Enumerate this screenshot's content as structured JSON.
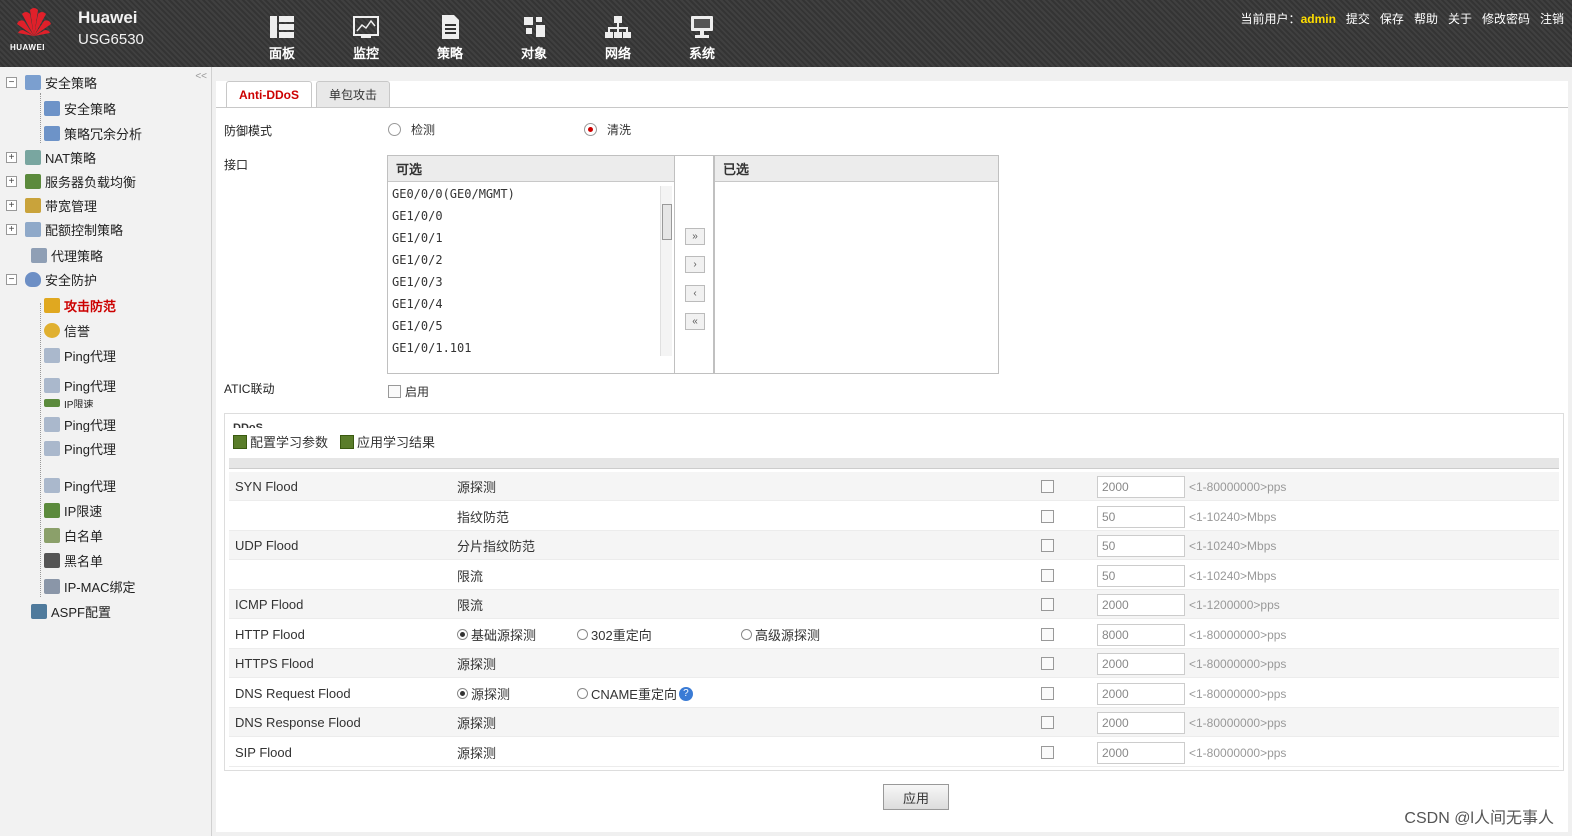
{
  "header": {
    "logo_text": "HUAWEI",
    "brand": "Huawei",
    "model": "USG6530",
    "nav": [
      {
        "label": "面板",
        "icon": "dashboard-icon"
      },
      {
        "label": "监控",
        "icon": "monitor-icon"
      },
      {
        "label": "策略",
        "icon": "policy-icon"
      },
      {
        "label": "对象",
        "icon": "object-icon"
      },
      {
        "label": "网络",
        "icon": "network-icon"
      },
      {
        "label": "系统",
        "icon": "system-icon"
      }
    ],
    "user_prefix": "当前用户：",
    "user": "admin",
    "links": [
      "提交",
      "保存",
      "帮助",
      "关于",
      "修改密码",
      "注销"
    ]
  },
  "sidebar": {
    "collapse": "<<",
    "items": [
      {
        "label": "安全策略",
        "expander": "−"
      },
      {
        "label": "安全策略"
      },
      {
        "label": "策略冗余分析"
      },
      {
        "label": "NAT策略",
        "expander": "+"
      },
      {
        "label": "服务器负载均衡",
        "expander": "+"
      },
      {
        "label": "带宽管理",
        "expander": "+"
      },
      {
        "label": "配额控制策略",
        "expander": "+"
      },
      {
        "label": "代理策略"
      },
      {
        "label": "安全防护",
        "expander": "−"
      },
      {
        "label": "攻击防范"
      },
      {
        "label": "信誉"
      },
      {
        "label": "Ping代理"
      },
      {
        "label": "Ping代理"
      },
      {
        "label": "IP限速"
      },
      {
        "label": "Ping代理"
      },
      {
        "label": "Ping代理"
      },
      {
        "label": "Ping代理"
      },
      {
        "label": "IP限速"
      },
      {
        "label": "白名单"
      },
      {
        "label": "黑名单"
      },
      {
        "label": "IP-MAC绑定"
      },
      {
        "label": "ASPF配置"
      }
    ]
  },
  "tabs": [
    "Anti-DDoS",
    "单包攻击"
  ],
  "form": {
    "mode_label": "防御模式",
    "mode_options": [
      "检测",
      "清洗"
    ],
    "interface_label": "接口",
    "available_header": "可选",
    "selected_header": "已选",
    "interfaces": [
      "GE0/0/0(GE0/MGMT)",
      "GE1/0/0",
      "GE1/0/1",
      "GE1/0/2",
      "GE1/0/3",
      "GE1/0/4",
      "GE1/0/5",
      "GE1/0/1.101"
    ],
    "move_buttons": [
      "»",
      "›",
      "‹",
      "«"
    ],
    "atic_label": "ATIC联动",
    "atic_option": "启用"
  },
  "ddos": {
    "title": "DDoS",
    "toolbar": [
      "配置学习参数",
      "应用学习结果"
    ],
    "rows": [
      {
        "type": "SYN Flood",
        "method": "源探测",
        "value": "2000",
        "range": "<1-80000000>pps"
      },
      {
        "type": "",
        "method": "指纹防范",
        "value": "50",
        "range": "<1-10240>Mbps"
      },
      {
        "type": "UDP Flood",
        "method": "分片指纹防范",
        "value": "50",
        "range": "<1-10240>Mbps"
      },
      {
        "type": "",
        "method": "限流",
        "value": "50",
        "range": "<1-10240>Mbps"
      },
      {
        "type": "ICMP Flood",
        "method": "限流",
        "value": "2000",
        "range": "<1-1200000>pps"
      },
      {
        "type": "HTTP Flood",
        "options": [
          "基础源探测",
          "302重定向",
          "高级源探测"
        ],
        "value": "8000",
        "range": "<1-80000000>pps"
      },
      {
        "type": "HTTPS Flood",
        "method": "源探测",
        "value": "2000",
        "range": "<1-80000000>pps"
      },
      {
        "type": "DNS Request Flood",
        "options": [
          "源探测",
          "CNAME重定向"
        ],
        "value": "2000",
        "range": "<1-80000000>pps"
      },
      {
        "type": "DNS Response Flood",
        "method": "源探测",
        "value": "2000",
        "range": "<1-80000000>pps"
      },
      {
        "type": "SIP Flood",
        "method": "源探测",
        "value": "2000",
        "range": "<1-80000000>pps"
      }
    ]
  },
  "apply_label": "应用",
  "watermark": "CSDN @l人间无事人",
  "colors": {
    "header_bg": "#3a3a3a",
    "accent": "#cc0000",
    "user": "#ffde00"
  }
}
